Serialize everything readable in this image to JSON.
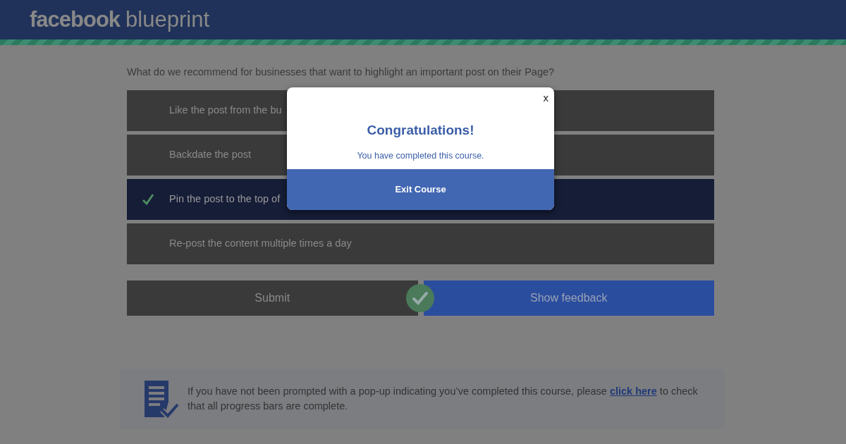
{
  "header": {
    "logo_bold": "facebook",
    "logo_light": "blueprint"
  },
  "question": "What do we recommend for businesses that want to highlight an important post on their Page?",
  "options": [
    {
      "text": "Like the post from the bu",
      "selected": false
    },
    {
      "text": "Backdate the post",
      "selected": false
    },
    {
      "text": "Pin the post to the top of",
      "selected": true
    },
    {
      "text": "Re-post the content multiple times a day",
      "selected": false
    }
  ],
  "actions": {
    "submit": "Submit",
    "show_feedback": "Show feedback"
  },
  "notice": {
    "before": "If you have not been prompted with a pop-up indicating you’ve completed this course, please ",
    "link": "click here",
    "after": " to check that all progress bars are complete."
  },
  "modal": {
    "close": "x",
    "title": "Congratulations!",
    "message": "You have completed this course.",
    "button": "Exit Course"
  }
}
